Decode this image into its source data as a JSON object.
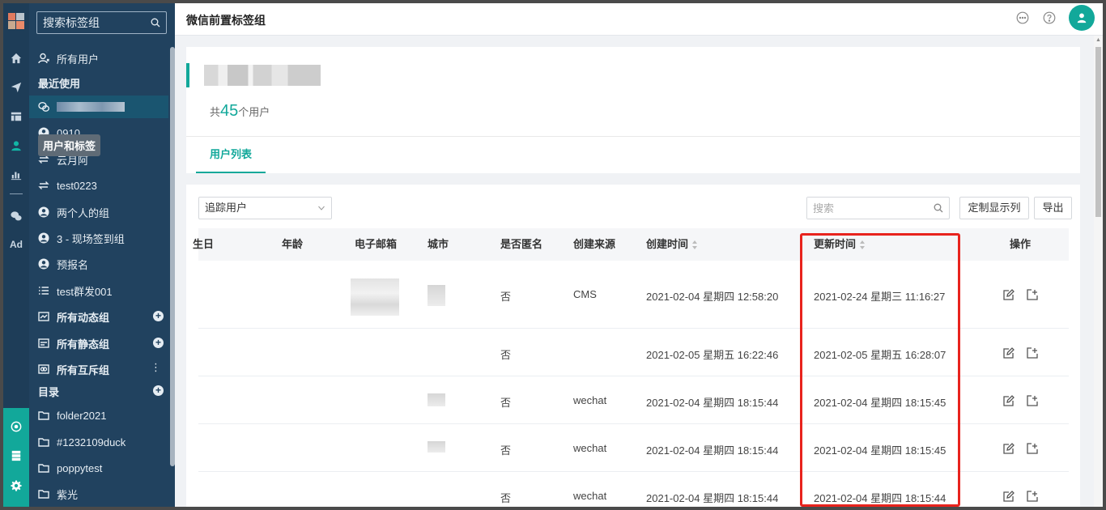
{
  "sidebar": {
    "search_placeholder": "搜索标签组",
    "all_users": "所有用户",
    "recent_label": "最近使用",
    "items": [
      {
        "label": "0910"
      },
      {
        "label": "云月阿"
      },
      {
        "label": "test0223"
      },
      {
        "label": "两个人的组"
      },
      {
        "label": "3 - 现场签到组"
      },
      {
        "label": "预报名"
      },
      {
        "label": "test群发001"
      },
      {
        "label": "所有动态组"
      },
      {
        "label": "所有静态组"
      },
      {
        "label": "所有互斥组"
      }
    ],
    "catalog_label": "目录",
    "folders": [
      {
        "label": "folder2021"
      },
      {
        "label": "#1232109duck"
      },
      {
        "label": "poppytest"
      },
      {
        "label": "紫光"
      }
    ],
    "tooltip": "用户和标签",
    "rail_ad": "Ad"
  },
  "topbar": {
    "title": "微信前置标签组"
  },
  "header": {
    "count_prefix": "共",
    "count": "45",
    "count_suffix": "个用户",
    "tab_label": "用户列表"
  },
  "toolbar": {
    "filter_value": "追踪用户",
    "search_placeholder": "搜索",
    "custom_columns_label": "定制显示列",
    "export_label": "导出"
  },
  "table": {
    "columns": [
      "生日",
      "年龄",
      "电子邮箱",
      "城市",
      "是否匿名",
      "创建来源",
      "创建时间",
      "更新时间",
      "操作"
    ],
    "rows": [
      {
        "anonymous": "否",
        "source": "CMS",
        "created": "2021-02-04 星期四 12:58:20",
        "updated": "2021-02-24 星期三 11:16:27"
      },
      {
        "anonymous": "否",
        "source": "",
        "created": "2021-02-05 星期五 16:22:46",
        "updated": "2021-02-05 星期五 16:28:07"
      },
      {
        "anonymous": "否",
        "source": "wechat",
        "created": "2021-02-04 星期四 18:15:44",
        "updated": "2021-02-04 星期四 18:15:45"
      },
      {
        "anonymous": "否",
        "source": "wechat",
        "created": "2021-02-04 星期四 18:15:44",
        "updated": "2021-02-04 星期四 18:15:45"
      },
      {
        "anonymous": "否",
        "source": "wechat",
        "created": "2021-02-04 星期四 18:15:44",
        "updated": "2021-02-04 星期四 18:15:44"
      }
    ]
  },
  "colors": {
    "accent": "#12a89a",
    "sidebar_bg": "#21425f",
    "highlight": "#e8231d"
  }
}
